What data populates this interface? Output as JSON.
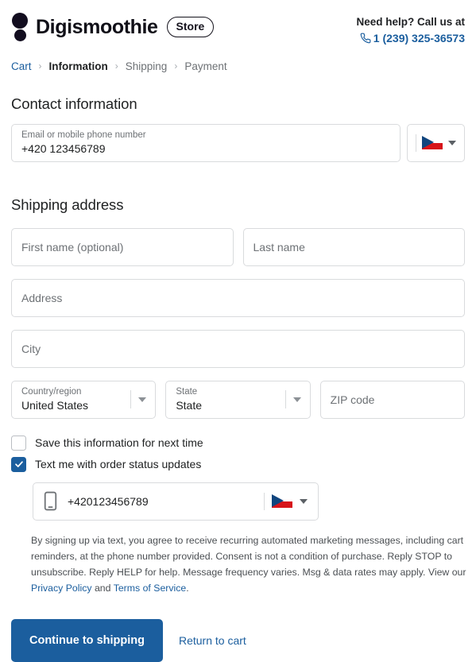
{
  "header": {
    "brand_name": "Digismoothie",
    "store_pill": "Store",
    "logo_icon": "digismoothie-dots-logo",
    "help_title": "Need help? Call us at",
    "help_phone": "1 (239) 325-36573",
    "phone_icon": "phone-icon"
  },
  "breadcrumb": {
    "items": [
      {
        "label": "Cart",
        "state": "link"
      },
      {
        "label": "Information",
        "state": "active"
      },
      {
        "label": "Shipping",
        "state": "inactive"
      },
      {
        "label": "Payment",
        "state": "inactive"
      }
    ],
    "separator": "›"
  },
  "contact": {
    "title": "Contact information",
    "email_label": "Email or mobile phone number",
    "email_value": "+420 123456789",
    "country_flag": "czech-republic-flag",
    "flag_caret": "chevron-down-icon"
  },
  "shipping": {
    "title": "Shipping address",
    "first_name_placeholder": "First name (optional)",
    "first_name_value": "",
    "last_name_placeholder": "Last name",
    "last_name_value": "",
    "address_placeholder": "Address",
    "address_value": "",
    "city_placeholder": "City",
    "city_value": "",
    "country_label": "Country/region",
    "country_value": "United States",
    "state_label": "State",
    "state_value": "State",
    "zip_placeholder": "ZIP code",
    "zip_value": ""
  },
  "options": {
    "save_info_label": "Save this information for next time",
    "save_info_checked": false,
    "text_updates_label": "Text me with order status updates",
    "text_updates_checked": true,
    "sms_phone_value": "+420123456789",
    "sms_phone_icon": "mobile-phone-icon",
    "sms_flag": "czech-republic-flag"
  },
  "legal": {
    "part1": "By signing up via text, you agree to receive recurring automated marketing messages, including cart reminders, at the phone number provided. Consent is not a condition of purchase. Reply STOP to unsubscribe. Reply HELP for help. Message frequency varies. Msg & data rates may apply. View our ",
    "privacy_link": "Privacy Policy",
    "part2": " and ",
    "terms_link": "Terms of Service",
    "part3": "."
  },
  "actions": {
    "continue_label": "Continue to shipping",
    "return_label": "Return to cart"
  },
  "colors": {
    "accent_blue": "#1b5e9e",
    "text_dark": "#202223",
    "text_muted": "#6d7175",
    "border": "#d9dbdd",
    "flag_red": "#d7141a",
    "flag_blue": "#11457e"
  }
}
